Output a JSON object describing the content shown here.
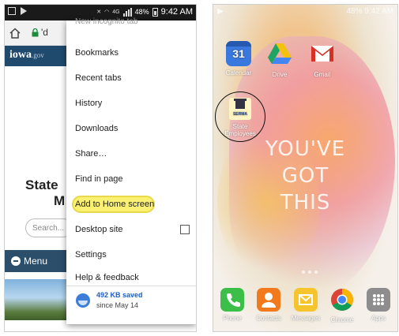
{
  "left_phone": {
    "status_time": "9:42 AM",
    "status_battery": "48%",
    "url_fragment": "'d",
    "site_logo": "iowa",
    "site_logo_suffix": ".gov",
    "page_heading_line1": "State",
    "page_heading_line2": "M",
    "search_placeholder": "Search...",
    "menu_label": "Menu",
    "overflow_menu": {
      "top_partial": "New incognito tab",
      "items": [
        "Bookmarks",
        "Recent tabs",
        "History",
        "Downloads",
        "Share…",
        "Find in page",
        "Add to Home screen",
        "Desktop site",
        "Settings",
        "Help & feedback"
      ],
      "saved_amount": "492 KB saved",
      "saved_since": "since May 14"
    }
  },
  "right_phone": {
    "status_time": "9:42 AM",
    "status_battery": "48%",
    "apps": [
      {
        "label": "Calendar",
        "icon": "calendar-icon",
        "badge": "31"
      },
      {
        "label": "Drive",
        "icon": "drive-icon"
      },
      {
        "label": "Gmail",
        "icon": "gmail-icon"
      }
    ],
    "shortcut": {
      "label": "State Employees",
      "icon_text": "SERMA"
    },
    "wallpaper_lines": [
      "YOU'VE",
      "GOT",
      "THIS"
    ],
    "dock": [
      {
        "label": "Phone",
        "icon": "phone-icon"
      },
      {
        "label": "Contacts",
        "icon": "contacts-icon"
      },
      {
        "label": "Messages",
        "icon": "messages-icon"
      },
      {
        "label": "Chrome",
        "icon": "chrome-icon"
      },
      {
        "label": "Apps",
        "icon": "apps-grid-icon"
      }
    ]
  },
  "colors": {
    "highlight": "#f7ee6a",
    "iowa_blue": "#1f4a6e",
    "chrome_blue": "#3b7dd8"
  }
}
